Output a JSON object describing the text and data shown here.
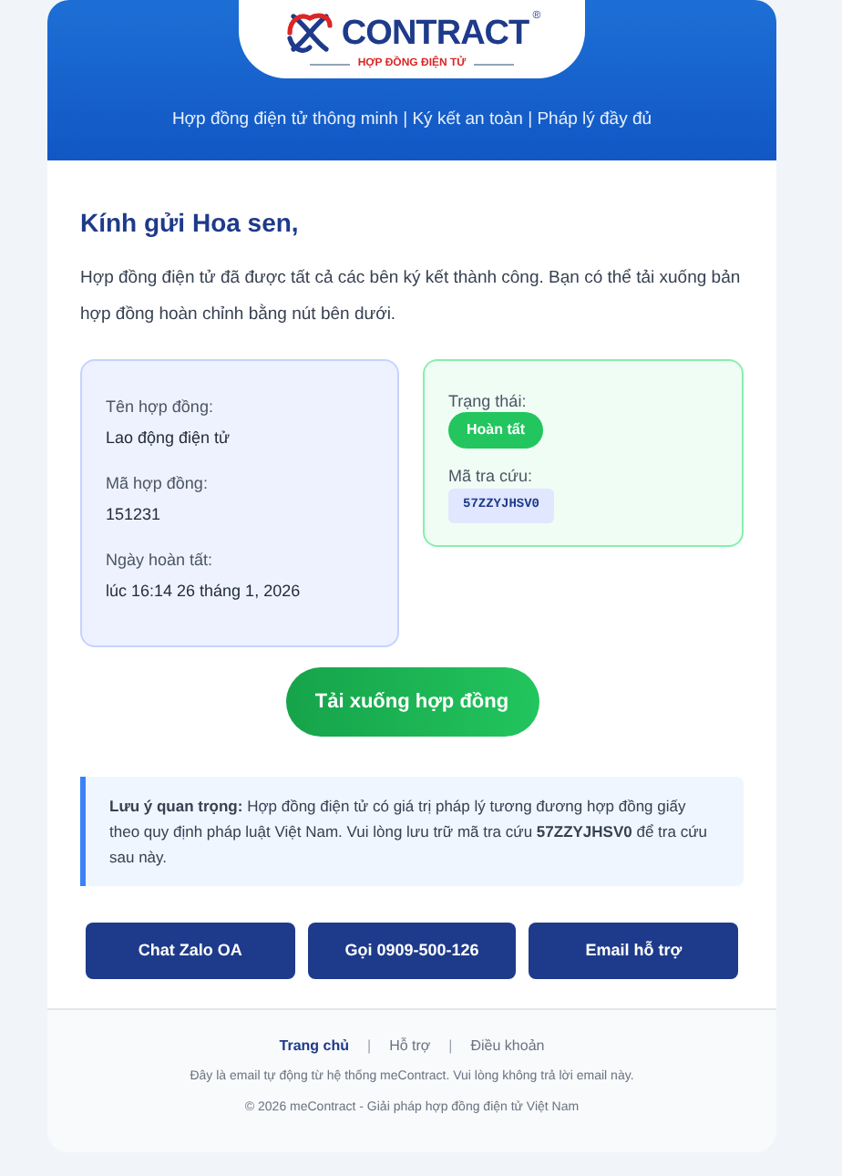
{
  "header": {
    "logo": {
      "wordmark": "CONTRACT",
      "registered": "®",
      "tagline": "HỢP ĐỒNG ĐIỆN TỬ"
    },
    "slogan": "Hợp đồng điện tử thông minh | Ký kết an toàn | Pháp lý đầy đủ"
  },
  "greeting": "Kính gửi Hoa sen,",
  "intro": "Hợp đồng điện tử đã được tất cả các bên ký kết thành công. Bạn có thể tải xuống bản hợp đồng hoàn chỉnh bằng nút bên dưới.",
  "details": [
    {
      "label": "Tên hợp đồng:",
      "value": "Lao động điện tử"
    },
    {
      "label": "Mã hợp đồng:",
      "value": "151231"
    },
    {
      "label": "Ngày hoàn tất:",
      "value": "lúc 16:14 26 tháng 1, 2026"
    }
  ],
  "status": {
    "label": "Trạng thái:",
    "badge": "Hoàn tất",
    "lookup_label": "Mã tra cứu:",
    "lookup_code": "57ZZYJHSV0"
  },
  "download_button": "Tải xuống hợp đồng",
  "note": "**Lưu ý quan trọng:** Hợp đồng điện tử có giá trị pháp lý tương đương hợp đồng giấy theo quy định pháp luật Việt Nam. Vui lòng lưu trữ mã tra cứu **57ZZYJHSV0** để tra cứu sau này.",
  "contact_buttons": [
    "Chat Zalo OA",
    "Gọi 0909-500-126",
    "Email hỗ trợ"
  ],
  "footer": {
    "links": [
      {
        "label": "Trang chủ",
        "selected": true
      },
      {
        "label": "Hỗ trợ",
        "selected": false
      },
      {
        "label": "Điều khoản",
        "selected": false
      }
    ],
    "separator": "|",
    "disclaimer": "Đây là email tự động từ hệ thống meContract. Vui lòng không trả lời email này.",
    "copyright": "© 2026 meContract - Giải pháp hợp đồng điện tử Việt Nam"
  }
}
